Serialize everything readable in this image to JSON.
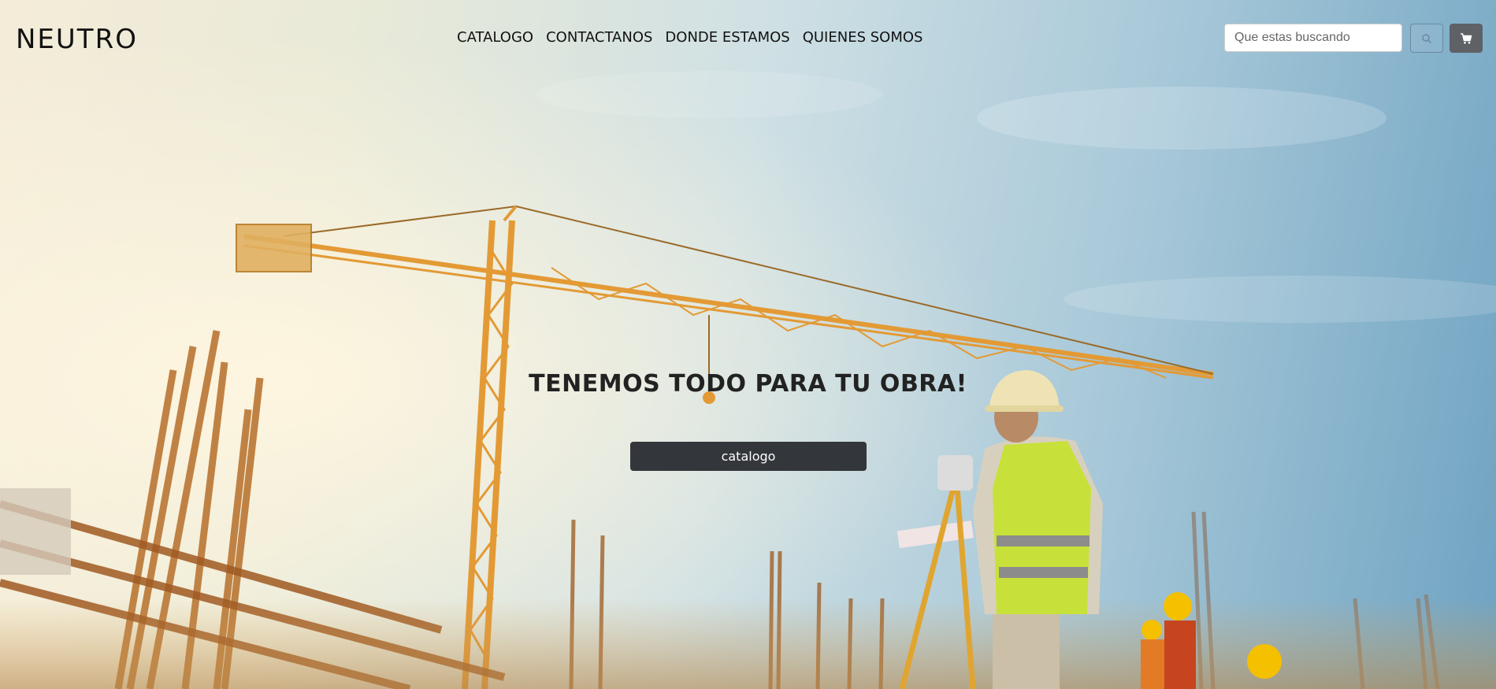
{
  "brand": {
    "logo_text": "NEUTRO"
  },
  "nav": {
    "items": [
      {
        "label": "CATALOGO"
      },
      {
        "label": "CONTACTANOS"
      },
      {
        "label": "DONDE ESTAMOS"
      },
      {
        "label": "QUIENES SOMOS"
      }
    ]
  },
  "search": {
    "placeholder": "Que estas buscando",
    "value": "",
    "button_icon": "search-icon"
  },
  "cart": {
    "icon": "cart-icon"
  },
  "hero": {
    "title": "TENEMOS TODO PARA TU OBRA!",
    "button_label": "catalogo",
    "background": "construction-site-photo"
  },
  "colors": {
    "nav_text": "#111111",
    "hero_button_bg": "#33363b",
    "cart_button_bg": "#5e6166",
    "crane": "#e8a23a"
  }
}
